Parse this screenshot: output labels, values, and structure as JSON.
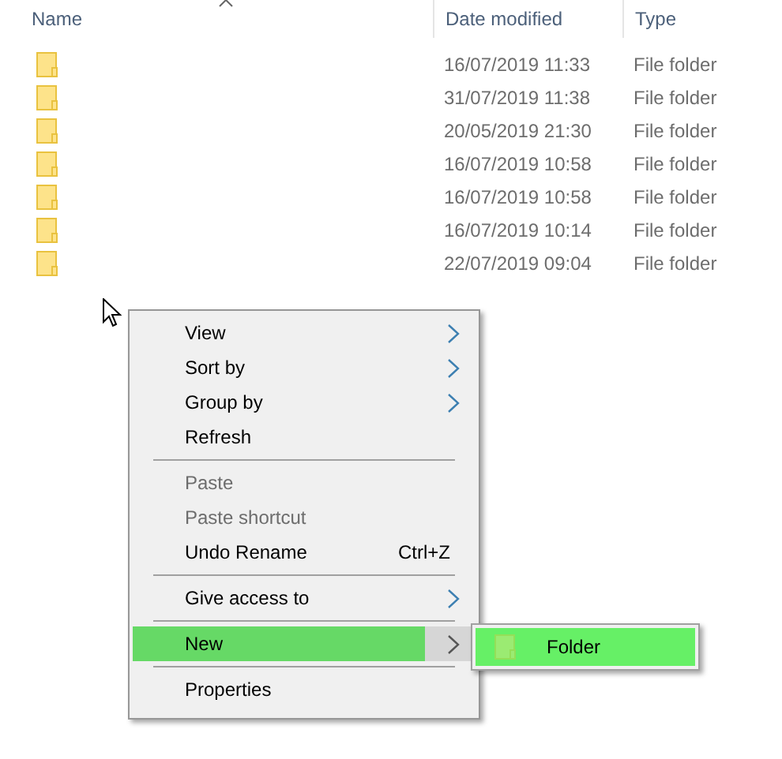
{
  "columns": [
    {
      "label": "Name"
    },
    {
      "label": "Date modified"
    },
    {
      "label": "Type"
    }
  ],
  "rows": [
    {
      "date_modified": "16/07/2019 11:33",
      "type": "File folder"
    },
    {
      "date_modified": "31/07/2019 11:38",
      "type": "File folder"
    },
    {
      "date_modified": "20/05/2019 21:30",
      "type": "File folder"
    },
    {
      "date_modified": "16/07/2019 10:58",
      "type": "File folder"
    },
    {
      "date_modified": "16/07/2019 10:58",
      "type": "File folder"
    },
    {
      "date_modified": "16/07/2019 10:14",
      "type": "File folder"
    },
    {
      "date_modified": "22/07/2019 09:04",
      "type": "File folder"
    }
  ],
  "context_menu": {
    "items": [
      {
        "kind": "item",
        "label": "View",
        "submenu": true,
        "disabled": false,
        "selected": false
      },
      {
        "kind": "item",
        "label": "Sort by",
        "submenu": true,
        "disabled": false,
        "selected": false
      },
      {
        "kind": "item",
        "label": "Group by",
        "submenu": true,
        "disabled": false,
        "selected": false
      },
      {
        "kind": "item",
        "label": "Refresh",
        "submenu": false,
        "disabled": false,
        "selected": false
      },
      {
        "kind": "separator"
      },
      {
        "kind": "item",
        "label": "Paste",
        "submenu": false,
        "disabled": true,
        "selected": false
      },
      {
        "kind": "item",
        "label": "Paste shortcut",
        "submenu": false,
        "disabled": true,
        "selected": false
      },
      {
        "kind": "item",
        "label": "Undo Rename",
        "shortcut": "Ctrl+Z",
        "submenu": false,
        "disabled": false,
        "selected": false
      },
      {
        "kind": "separator"
      },
      {
        "kind": "item",
        "label": "Give access to",
        "submenu": true,
        "disabled": false,
        "selected": false
      },
      {
        "kind": "separator"
      },
      {
        "kind": "item",
        "label": "New",
        "submenu": true,
        "disabled": false,
        "selected": true
      },
      {
        "kind": "separator"
      },
      {
        "kind": "item",
        "label": "Properties",
        "submenu": false,
        "disabled": false,
        "selected": false
      }
    ]
  },
  "submenu": {
    "items": [
      {
        "label": "Folder",
        "selected": true
      }
    ]
  }
}
